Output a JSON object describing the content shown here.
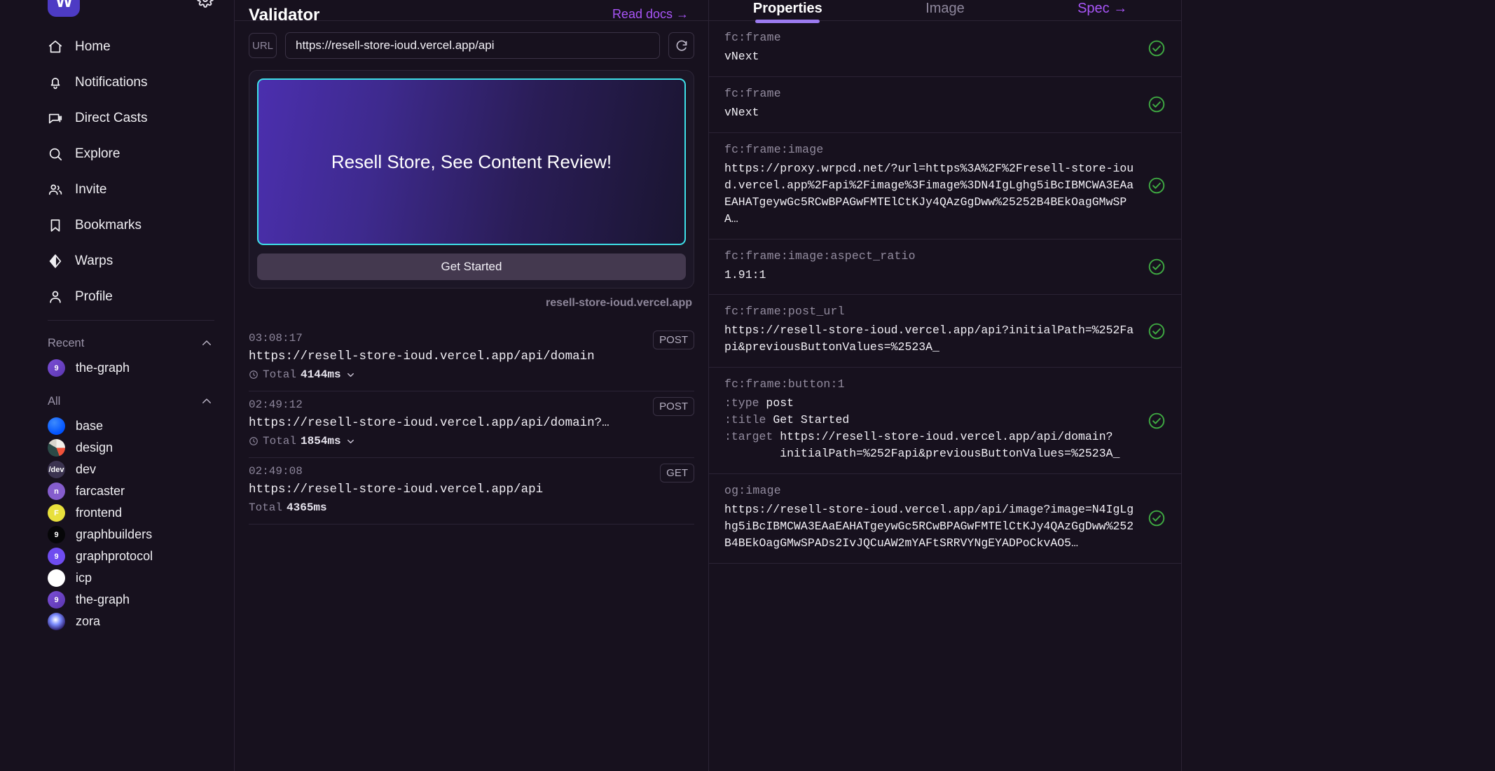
{
  "sidebar": {
    "logo_text": "W",
    "gear_icon": "gear-icon",
    "nav": [
      {
        "label": "Home",
        "icon": "home-icon"
      },
      {
        "label": "Notifications",
        "icon": "bell-icon"
      },
      {
        "label": "Direct Casts",
        "icon": "chat-bubbles-icon"
      },
      {
        "label": "Explore",
        "icon": "search-icon"
      },
      {
        "label": "Invite",
        "icon": "users-icon"
      },
      {
        "label": "Bookmarks",
        "icon": "bookmark-icon"
      },
      {
        "label": "Warps",
        "icon": "warps-diamond-icon"
      },
      {
        "label": "Profile",
        "icon": "person-icon"
      }
    ],
    "recent": {
      "label": "Recent",
      "items": [
        {
          "label": "the-graph",
          "avatar": "av-thegraph"
        }
      ]
    },
    "all": {
      "label": "All",
      "items": [
        {
          "label": "base",
          "avatar": "av-base",
          "glyph": ""
        },
        {
          "label": "design",
          "avatar": "av-design",
          "glyph": ""
        },
        {
          "label": "dev",
          "avatar": "av-dev",
          "glyph": "/dev"
        },
        {
          "label": "farcaster",
          "avatar": "av-farcaster",
          "glyph": "n"
        },
        {
          "label": "frontend",
          "avatar": "av-frontend",
          "glyph": "F"
        },
        {
          "label": "graphbuilders",
          "avatar": "av-graphbuilders",
          "glyph": "9"
        },
        {
          "label": "graphprotocol",
          "avatar": "av-graphprotocol",
          "glyph": "9"
        },
        {
          "label": "icp",
          "avatar": "av-icp",
          "glyph": "∞"
        },
        {
          "label": "the-graph",
          "avatar": "av-thegraph",
          "glyph": "9"
        },
        {
          "label": "zora",
          "avatar": "av-zora",
          "glyph": ""
        }
      ]
    }
  },
  "validator": {
    "title": "Validator",
    "read_docs": "Read docs →",
    "url_tag": "URL",
    "url_value": "https://resell-store-ioud.vercel.app/api",
    "url_placeholder": "https://",
    "refresh_icon": "refresh-icon",
    "frame": {
      "image_text": "Resell Store, See Content Review!",
      "button_label": "Get Started",
      "domain": "resell-store-ioud.vercel.app"
    },
    "logs": [
      {
        "time": "03:08:17",
        "url": "https://resell-store-ioud.vercel.app/api/domain",
        "total_label": "Total",
        "total_value": "4144ms",
        "method": "POST",
        "expandable": true
      },
      {
        "time": "02:49:12",
        "url": "https://resell-store-ioud.vercel.app/api/domain?…",
        "total_label": "Total",
        "total_value": "1854ms",
        "method": "POST",
        "expandable": true
      },
      {
        "time": "02:49:08",
        "url": "https://resell-store-ioud.vercel.app/api",
        "total_label": "Total",
        "total_value": "4365ms",
        "method": "GET",
        "expandable": false
      }
    ]
  },
  "properties": {
    "tabs": [
      {
        "label": "Properties",
        "active": true,
        "link": false
      },
      {
        "label": "Image",
        "active": false,
        "link": false
      },
      {
        "label": "Spec →",
        "active": false,
        "link": true
      }
    ],
    "status_icon": "check-circle-icon",
    "items": [
      {
        "key": "fc:frame",
        "value": "vNext",
        "status": "valid"
      },
      {
        "key": "fc:frame",
        "value": "vNext",
        "status": "valid"
      },
      {
        "key": "fc:frame:image",
        "value": "https://proxy.wrpcd.net/?url=https%3A%2F%2Fresell-store-ioud.vercel.app%2Fapi%2Fimage%3Fimage%3DN4IgLghg5iBcIBMCWA3EAaEAHATgeywGc5RCwBPAGwFMTElCtKJy4QAzGgDww%25252B4BEkOagGMwSPA…",
        "status": "valid"
      },
      {
        "key": "fc:frame:image:aspect_ratio",
        "value": "1.91:1",
        "status": "valid"
      },
      {
        "key": "fc:frame:post_url",
        "value": "https://resell-store-ioud.vercel.app/api?initialPath=%252Fapi&previousButtonValues=%2523A_",
        "status": "valid"
      },
      {
        "key": "fc:frame:button:1",
        "lines": [
          {
            "label": ":type",
            "text": "post"
          },
          {
            "label": ":title",
            "text": "Get Started"
          },
          {
            "label": ":target",
            "text": "https://resell-store-ioud.vercel.app/api/domain?\n        initialPath=%252Fapi&previousButtonValues=%2523A_"
          }
        ],
        "status": "valid"
      },
      {
        "key": "og:image",
        "value": "https://resell-store-ioud.vercel.app/api/image?image=N4IgLghg5iBcIBMCWA3EAaEAHATgeywGc5RCwBPAGwFMTElCtKJy4QAzGgDww%252B4BEkOagGMwSPADs2IvJQCuAW2mYAFtSRRVYNgEYADPoCkvAO5…",
        "status": "valid"
      }
    ]
  }
}
